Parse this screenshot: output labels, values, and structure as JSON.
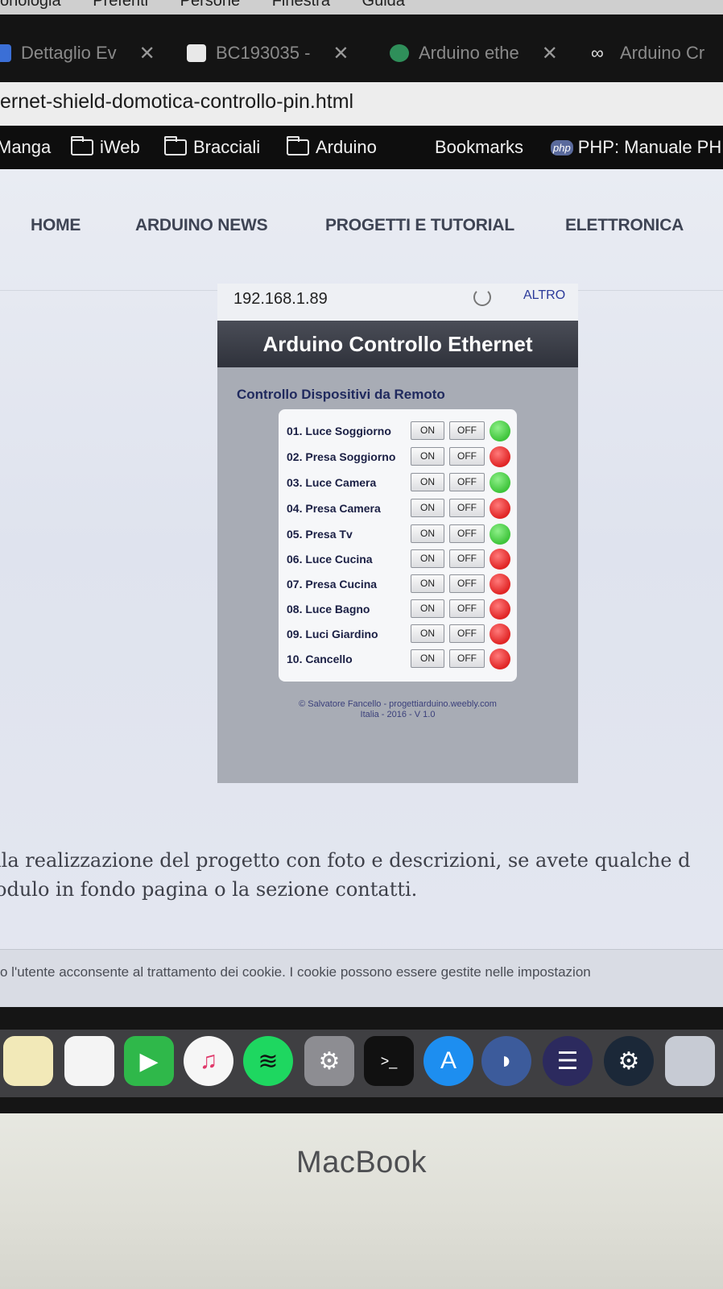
{
  "menubar": {
    "items": [
      "onologia",
      "Preferiti",
      "Persone",
      "Finestra",
      "Guida"
    ]
  },
  "tabs": [
    {
      "title": "Dettaglio Ev",
      "icon": "folder-icon"
    },
    {
      "title": "BC193035 -",
      "icon": "image-icon"
    },
    {
      "title": "Arduino ethe",
      "icon": "arduino-icon"
    },
    {
      "title": "Arduino Cr",
      "icon": "infinity-icon"
    }
  ],
  "url": "ernet-shield-domotica-controllo-pin.html",
  "bookmarks": [
    {
      "label": "Manga",
      "type": "text"
    },
    {
      "label": "iWeb",
      "type": "folder"
    },
    {
      "label": "Bracciali",
      "type": "folder"
    },
    {
      "label": "Arduino",
      "type": "folder"
    },
    {
      "label": "Bookmarks",
      "type": "text"
    },
    {
      "label": "PHP: Manuale PH",
      "type": "php"
    }
  ],
  "nav": [
    "HOME",
    "ARDUINO NEWS",
    "PROGETTI E TUTORIAL",
    "ELETTRONICA"
  ],
  "screenshot": {
    "ip": "192.168.1.89",
    "altro": "ALTRO",
    "title": "Arduino Controllo Ethernet",
    "subtitle": "Controllo Dispositivi da Remoto",
    "on_label": "ON",
    "off_label": "OFF",
    "devices": [
      {
        "name": "01. Luce Soggiorno",
        "state": "green"
      },
      {
        "name": "02. Presa Soggiorno",
        "state": "red"
      },
      {
        "name": "03. Luce Camera",
        "state": "green"
      },
      {
        "name": "04. Presa Camera",
        "state": "red"
      },
      {
        "name": "05. Presa Tv",
        "state": "green"
      },
      {
        "name": "06. Luce Cucina",
        "state": "red"
      },
      {
        "name": "07. Presa Cucina",
        "state": "red"
      },
      {
        "name": "08. Luce Bagno",
        "state": "red"
      },
      {
        "name": "09. Luci Giardino",
        "state": "red"
      },
      {
        "name": "10. Cancello",
        "state": "red"
      }
    ],
    "credit_line1": "© Salvatore Fancello - progettiarduino.weebly.com",
    "credit_line2": "Italia - 2016 - V 1.0"
  },
  "paragraph": {
    "line1": "lla realizzazione del progetto con foto e descrizioni, se avete qualche d",
    "line2": "odulo in fondo pagina o la sezione contatti."
  },
  "cookie_text": "o l'utente acconsente al trattamento dei cookie. I cookie possono essere gestite nelle impostazion",
  "dock": [
    "notes-icon",
    "reminders-icon",
    "facetime-icon",
    "itunes-icon",
    "spotify-icon",
    "system-preferences-icon",
    "terminal-icon",
    "app-store-icon",
    "wireshark-icon",
    "eclipse-icon",
    "steam-icon",
    "preview-icon"
  ],
  "laptop_brand": "MacBook",
  "colors": {
    "led_on": "#3ec43a",
    "led_off": "#e02424",
    "header_bg": "#2f323b"
  }
}
